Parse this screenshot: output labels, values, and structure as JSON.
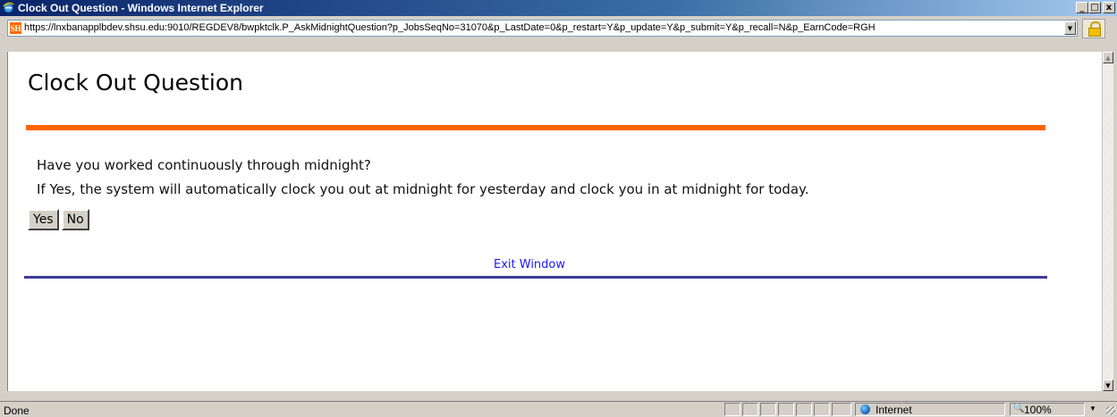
{
  "window": {
    "title": "Clock Out Question - Windows Internet Explorer",
    "minimize_glyph": "_",
    "maximize_glyph": "□",
    "close_glyph": "x"
  },
  "address_bar": {
    "favicon_text": "SH",
    "url": "https://lnxbanapplbdev.shsu.edu:9010/REGDEV8/bwpktclk.P_AskMidnightQuestion?p_JobsSeqNo=31070&p_LastDate=0&p_restart=Y&p_update=Y&p_submit=Y&p_recall=N&p_EarnCode=RGH",
    "dropdown_glyph": "▼"
  },
  "page": {
    "title": "Clock Out Question",
    "question": "Have you worked continuously through midnight?",
    "explanation": "If Yes, the system will automatically clock you out at midnight for yesterday and clock you in at midnight for today.",
    "yes_label": "Yes",
    "no_label": "No",
    "exit_link": "Exit Window"
  },
  "status_bar": {
    "status": "Done",
    "zone": "Internet",
    "zoom": "100%",
    "zoom_dropdown_glyph": "▼"
  },
  "colors": {
    "accent_rule": "#ff6600",
    "footer_rule": "#3c3c96",
    "link": "#1a1aff"
  }
}
